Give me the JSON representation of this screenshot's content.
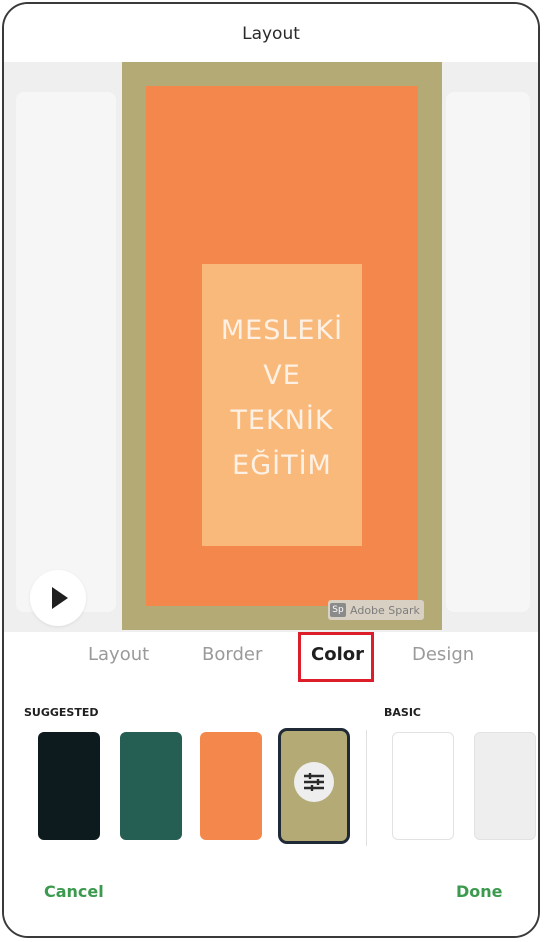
{
  "header": {
    "title": "Layout"
  },
  "poster": {
    "lines": [
      "MESLEKİ",
      "VE",
      "TEKNİK",
      "EĞİTİM"
    ],
    "watermark": {
      "logo": "Sp",
      "text": "Adobe Spark"
    },
    "colors": {
      "border": "#b3aa76",
      "background": "#f4874b",
      "textBlock": "#f9b97a",
      "text": "#fdf1e5"
    }
  },
  "controls": {
    "play_icon": "play-icon"
  },
  "tabs": [
    {
      "label": "Layout"
    },
    {
      "label": "Border"
    },
    {
      "label": "Color",
      "active": true
    },
    {
      "label": "Design"
    }
  ],
  "swatches": {
    "suggested_label": "SUGGESTED",
    "basic_label": "BASIC",
    "suggested": [
      {
        "color": "#0d1a1e"
      },
      {
        "color": "#255e52"
      },
      {
        "color": "#f4874b"
      },
      {
        "color": "#b3aa76",
        "selected": true,
        "icon": "sliders-icon"
      }
    ],
    "basic": [
      {
        "color": "#ffffff"
      },
      {
        "color": "#eeeeee"
      }
    ]
  },
  "footer": {
    "cancel_label": "Cancel",
    "done_label": "Done",
    "accent": "#3c9a4f"
  },
  "highlight": {
    "color": "#dc1e2a"
  }
}
